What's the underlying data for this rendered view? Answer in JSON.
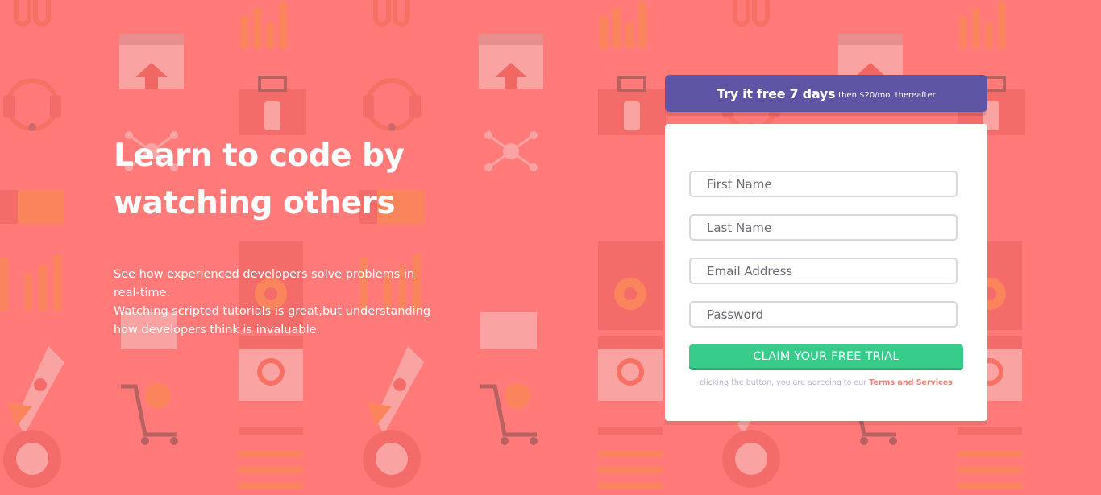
{
  "colors": {
    "background": "#ff7a79",
    "promo_bar": "#5e54a4",
    "cta": "#38cc8b",
    "terms_link": "#ff7a79",
    "card": "#ffffff"
  },
  "intro": {
    "heading_line1": "Learn to code by",
    "heading_line2": "watching others",
    "description_line1": "See how experienced developers solve problems in real-time.",
    "description_line2": "Watching scripted tutorials is great,but understanding how developers think is invaluable."
  },
  "promo": {
    "bold_text": "Try it free 7 days",
    "small_text": "then $20/mo. thereafter"
  },
  "form": {
    "first_name_placeholder": "First Name",
    "last_name_placeholder": "Last Name",
    "email_placeholder": "Email Address",
    "password_placeholder": "Password",
    "submit_label": "CLAIM YOUR FREE TRIAL",
    "terms_prefix": "clicking the button, you are agreeing to our ",
    "terms_link": "Terms and Services"
  },
  "background_icons": [
    "link-icon",
    "chart-icon",
    "browser-upload-icon",
    "headset-icon",
    "toolbox-icon",
    "network-icon",
    "thumbs-up-icon",
    "settings-icon",
    "edit-icon",
    "rocket-icon",
    "search-icon",
    "cart-icon",
    "globe-gear-icon",
    "key-icon",
    "list-icon"
  ]
}
